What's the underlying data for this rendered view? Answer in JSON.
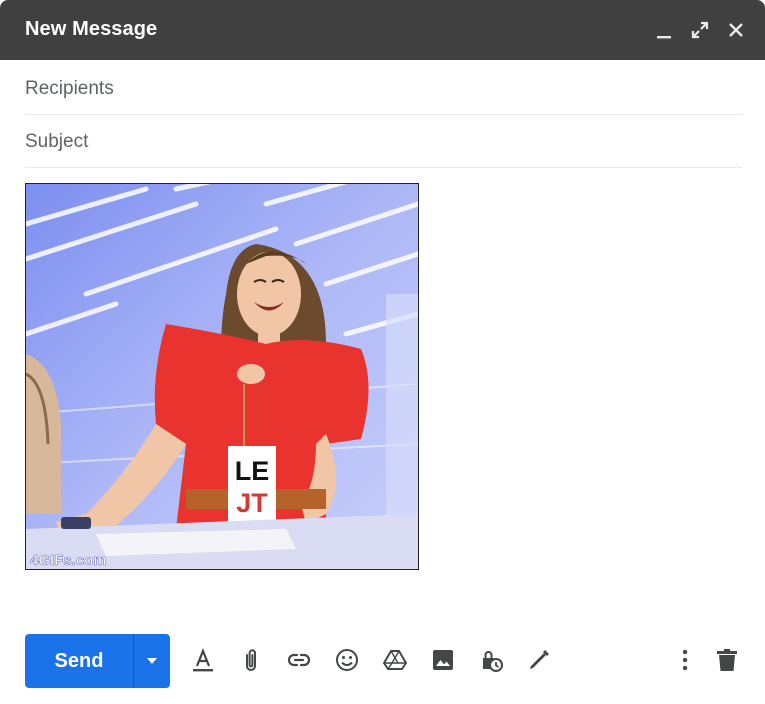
{
  "window": {
    "title": "New Message",
    "controls": [
      "minimize-icon",
      "expand-icon",
      "close-icon"
    ]
  },
  "fields": {
    "recipients_placeholder": "Recipients",
    "subject_placeholder": "Subject"
  },
  "attachment": {
    "watermark": "4GIFs.com",
    "badge_line1": "LE",
    "badge_line2": "JT"
  },
  "toolbar": {
    "send_label": "Send",
    "tools": [
      "text-format-icon",
      "attach-icon",
      "link-icon",
      "emoji-icon",
      "drive-icon",
      "photo-icon",
      "confidential-icon",
      "signature-icon"
    ],
    "right_tools": [
      "more-options-icon",
      "trash-icon"
    ]
  },
  "colors": {
    "titlebar": "#404040",
    "send": "#1a73e8",
    "icons": "#444746"
  }
}
